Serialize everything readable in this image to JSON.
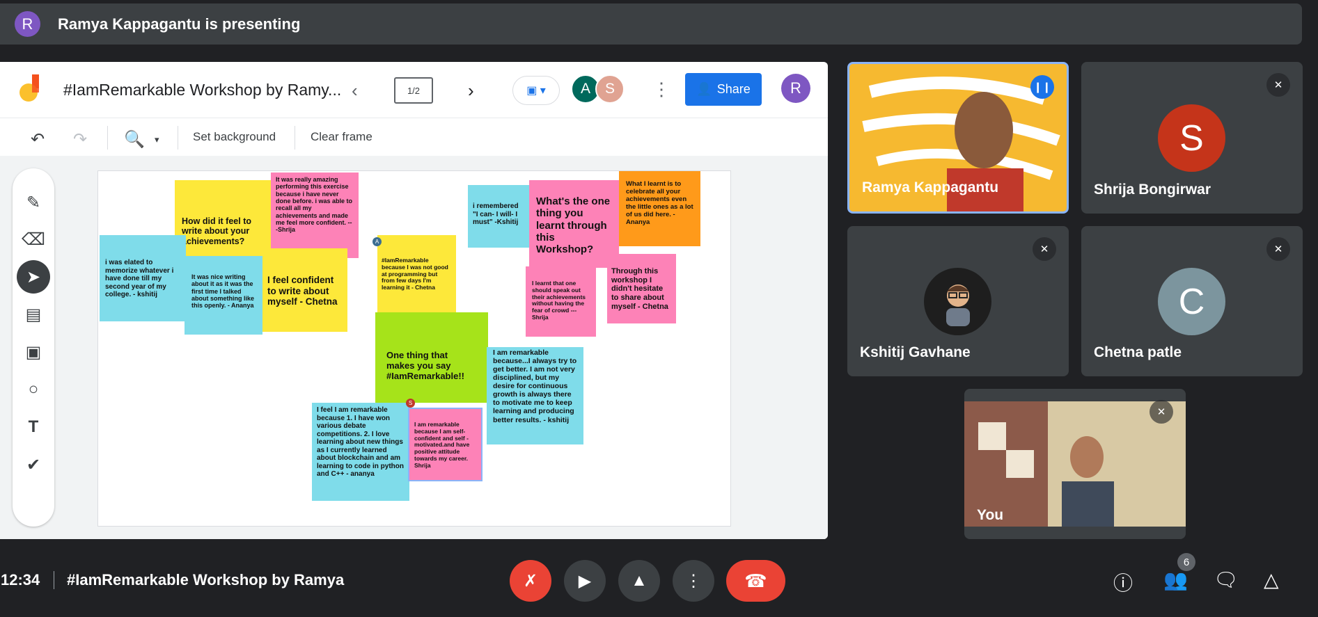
{
  "presenting_banner": {
    "avatar_letter": "R",
    "text": "Ramya Kappagantu is presenting"
  },
  "jamboard": {
    "title": "#IamRemarkable Workshop by Ramy...",
    "frame_counter": "1/2",
    "collaborators": [
      "A",
      "S"
    ],
    "share_label": "Share",
    "user_avatar": "R",
    "toolbar": {
      "set_background": "Set background",
      "clear_frame": "Clear frame"
    },
    "notes": [
      {
        "text": "How did it feel to write about your achievements?",
        "color": "yellow"
      },
      {
        "text": "It was really amazing performing this exercise because i have never done before. i was able to recall all my achievements and made me feel more confident. ---Shrija",
        "color": "pink"
      },
      {
        "text": "i was elated to memorize whatever i have done till my second year of my college. - kshitij",
        "color": "blue"
      },
      {
        "text": "It was nice writing about it as it was the first time I talked about something like this openly. - Ananya",
        "color": "blue"
      },
      {
        "text": "I feel confident to write about myself - Chetna",
        "color": "yellow"
      },
      {
        "text": "#IamRemarkable because I was not good at programming but from few days I'm learning it - Chetna",
        "color": "yellow"
      },
      {
        "text": "One thing that makes you say #IamRemarkable!!",
        "color": "green"
      },
      {
        "text": "I feel I am remarkable because 1. I have won various debate competitions. 2. I love learning about new things as I currently learned about blockchain and am learning to code in python and C++ - ananya",
        "color": "blue"
      },
      {
        "text": "I am remarkable because I am self-confident and self - motivated.and have positive attitude towards my career.  Shrija",
        "color": "pink"
      },
      {
        "text": "I am remarkable because...I  always try to get better. I am not very disciplined, but my desire for continuous growth is always there to motivate me to keep learning and producing better results. - kshitij",
        "color": "blue"
      },
      {
        "text": "i remembered \"I can- I will- I must\"  -Kshitij",
        "color": "blue"
      },
      {
        "text": "What's the one thing you learnt through this Workshop?",
        "color": "pink"
      },
      {
        "text": "What I learnt is to celebrate all your achievements even the little ones as a lot of us did here. -Ananya",
        "color": "orange"
      },
      {
        "text": "I learnt that one should speak out their achievements without having the fear of crowd ---Shrija",
        "color": "pink"
      },
      {
        "text": "Through this workshop I didn't hesitate to share about myself - Chetna",
        "color": "pink"
      }
    ],
    "cursor_labels": [
      "A",
      "S"
    ]
  },
  "participants": [
    {
      "name": "Ramya Kappagantu",
      "speaking": true
    },
    {
      "name": "Shrija Bongirwar",
      "avatar_letter": "S",
      "avatar_color": "#c5341a",
      "muted": true
    },
    {
      "name": "Kshitij Gavhane",
      "muted": true
    },
    {
      "name": "Chetna patle",
      "avatar_letter": "C",
      "avatar_color": "#7c959e",
      "muted": true
    },
    {
      "name": "You",
      "muted": true
    }
  ],
  "bottom_bar": {
    "time": "12:34",
    "meeting_title": "#IamRemarkable Workshop by Ramya",
    "people_count": "6"
  },
  "colors": {
    "background": "#202124",
    "tile": "#3c4043",
    "accent_blue": "#1a73e8",
    "red": "#ea4335"
  }
}
